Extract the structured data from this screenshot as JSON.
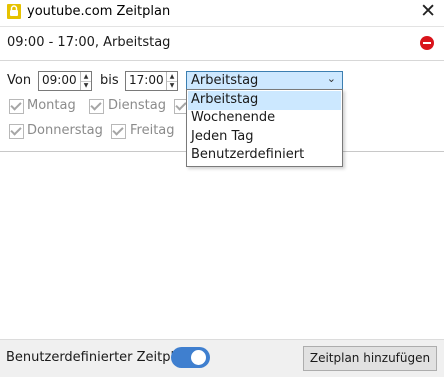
{
  "window": {
    "title": "youtube.com Zeitplan",
    "close_glyph": "✕"
  },
  "schedule": {
    "summary": "09:00 - 17:00, Arbeitstag",
    "remove_icon": "remove-icon"
  },
  "time": {
    "from_label": "Von",
    "from_value": "09:00",
    "to_label": "bis",
    "to_value": "17:00"
  },
  "preset": {
    "selected": "Arbeitstag",
    "options": [
      "Arbeitstag",
      "Wochenende",
      "Jeden Tag",
      "Benutzerdefiniert"
    ]
  },
  "days": [
    {
      "label": "Montag",
      "checked": true
    },
    {
      "label": "Dienstag",
      "checked": true
    },
    {
      "label": "Donnerstag",
      "checked": true
    },
    {
      "label": "Freitag",
      "checked": true
    }
  ],
  "footer": {
    "custom_label": "Benutzerdefinierter Zeitplan",
    "toggle_on": true,
    "add_button": "Zeitplan hinzufügen"
  },
  "colors": {
    "accent": "#3f7fcf",
    "remove": "#d9141b",
    "selected_bg": "#cce8ff"
  }
}
